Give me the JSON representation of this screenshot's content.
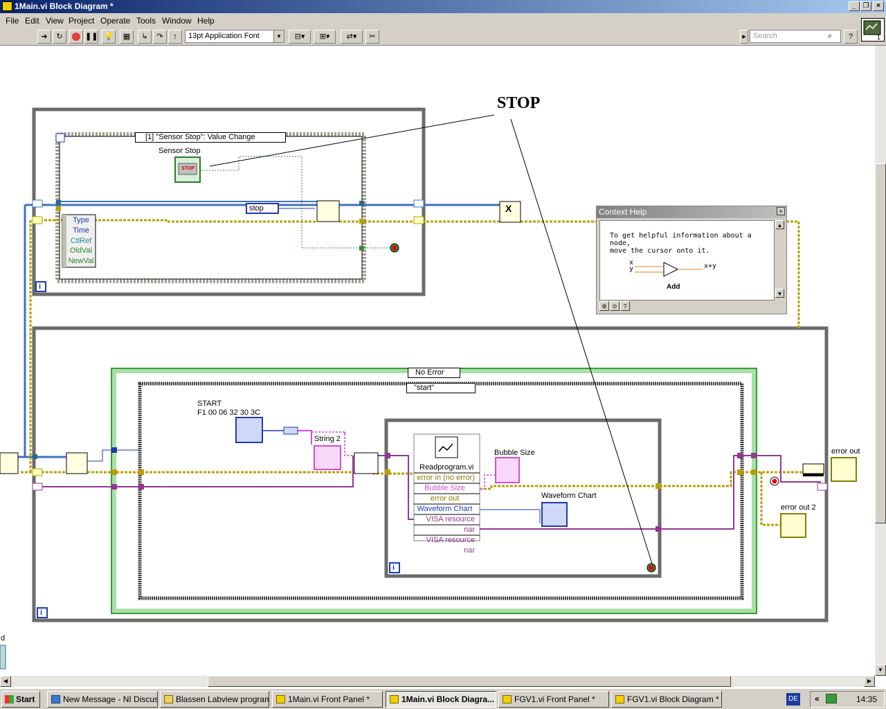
{
  "window": {
    "title": "1Main.vi Block Diagram *"
  },
  "menu": [
    "File",
    "Edit",
    "View",
    "Project",
    "Operate",
    "Tools",
    "Window",
    "Help"
  ],
  "toolbar": {
    "font": "13pt Application Font",
    "search_placeholder": "Search"
  },
  "diagram": {
    "annotation": "STOP",
    "event_case": "[1] \"Sensor Stop\": Value Change",
    "sensor_stop": "Sensor Stop",
    "stop_btn": "STOP",
    "stop_enum": "stop",
    "event_data": [
      "Type",
      "Time",
      "CtlRef",
      "OldVal",
      "NewVal"
    ],
    "case_no_error": "No Error",
    "case_start": "\"start\"",
    "start_label": "START",
    "start_hex": "F1 00 06 32 30 3C",
    "string2": "String 2",
    "bubble_size": "Bubble Size",
    "waveform_chart": "Waveform Chart",
    "subvi_name": "Readprogram.vi",
    "subvi_terms": [
      "error in (no error)",
      "Bubble Size",
      "error out",
      "Waveform Chart",
      "VISA resource nar",
      "VISA resource nar"
    ],
    "error_out": "error out",
    "error_out2": "error out 2",
    "loop_i": "i",
    "edge_d": "d"
  },
  "context_help": {
    "title": "Context Help",
    "text1": "To get helpful information about a node,",
    "text2": "move the cursor onto it.",
    "in_x": "x",
    "in_y": "y",
    "out": "x+y",
    "func": "Add"
  },
  "taskbar": {
    "start": "Start",
    "tasks": [
      "New Message - NI Discus...",
      "Blassen Labview program",
      "1Main.vi Front Panel *",
      "1Main.vi Block Diagra...",
      "FGV1.vi Front Panel *",
      "FGV1.vi Block Diagram *"
    ],
    "lang": "DE",
    "time": "14:35"
  }
}
